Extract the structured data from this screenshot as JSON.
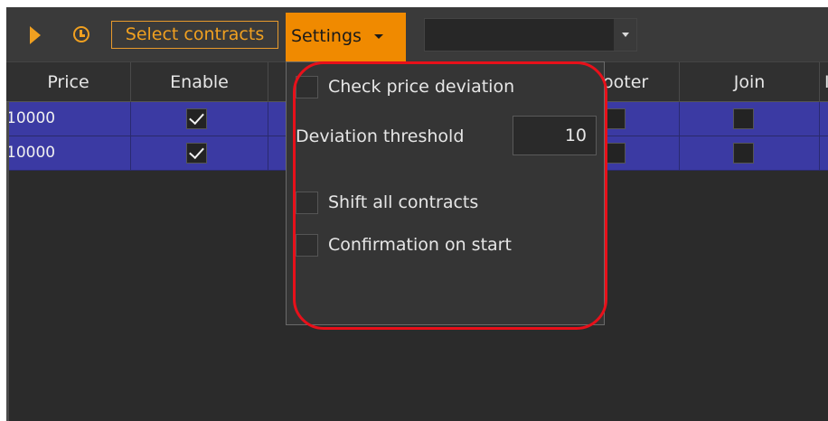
{
  "toolbar": {
    "select_contracts_label": "Select contracts",
    "settings_label": "Settings",
    "combo_value": ""
  },
  "grid": {
    "columns": [
      "Price",
      "Enable",
      "",
      "ooter",
      "Join",
      "I"
    ],
    "rows": [
      {
        "price": "10000",
        "enable": true,
        "footer": false,
        "join": false
      },
      {
        "price": "10000",
        "enable": true,
        "footer": false,
        "join": false
      }
    ]
  },
  "settings_panel": {
    "check_price_deviation": {
      "label": "Check price deviation",
      "checked": false
    },
    "deviation_threshold": {
      "label": "Deviation threshold",
      "value": "10"
    },
    "shift_all_contracts": {
      "label": "Shift all contracts",
      "checked": false
    },
    "confirmation_on_start": {
      "label": "Confirmation on start",
      "checked": false
    }
  },
  "colors": {
    "accent": "#f0a020",
    "settings_button": "#f08a00",
    "row_selected": "#3b3aa3",
    "highlight_ring": "#e8101a"
  },
  "icons": [
    "play-icon",
    "clock-icon",
    "chevron-down-icon"
  ]
}
